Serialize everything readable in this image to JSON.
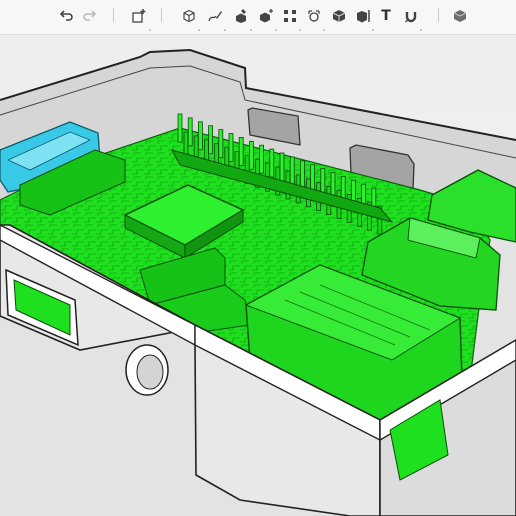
{
  "toolbar": {
    "buttons": [
      {
        "name": "undo-button",
        "icon": "undo-icon"
      },
      {
        "name": "redo-button",
        "icon": "redo-icon"
      },
      {
        "name": "add-object-button",
        "icon": "add-box-icon"
      },
      {
        "name": "primitives-button",
        "icon": "primitives-icon"
      },
      {
        "name": "sketch-button",
        "icon": "sketch-icon"
      },
      {
        "name": "construct-button",
        "icon": "construct-icon"
      },
      {
        "name": "modify-button",
        "icon": "modify-icon"
      },
      {
        "name": "pattern-button",
        "icon": "pattern-icon"
      },
      {
        "name": "grouping-button",
        "icon": "grouping-icon"
      },
      {
        "name": "combine-button",
        "icon": "combine-icon"
      },
      {
        "name": "measure-button",
        "icon": "measure-icon"
      },
      {
        "name": "text-button",
        "icon": "text-icon",
        "label": "T"
      },
      {
        "name": "snap-button",
        "icon": "magnet-icon"
      },
      {
        "name": "material-button",
        "icon": "material-icon"
      }
    ]
  },
  "viewport": {
    "board_color": "#1ee01e",
    "case_color": "#ffffff",
    "connector_color": "#38c9e6"
  }
}
